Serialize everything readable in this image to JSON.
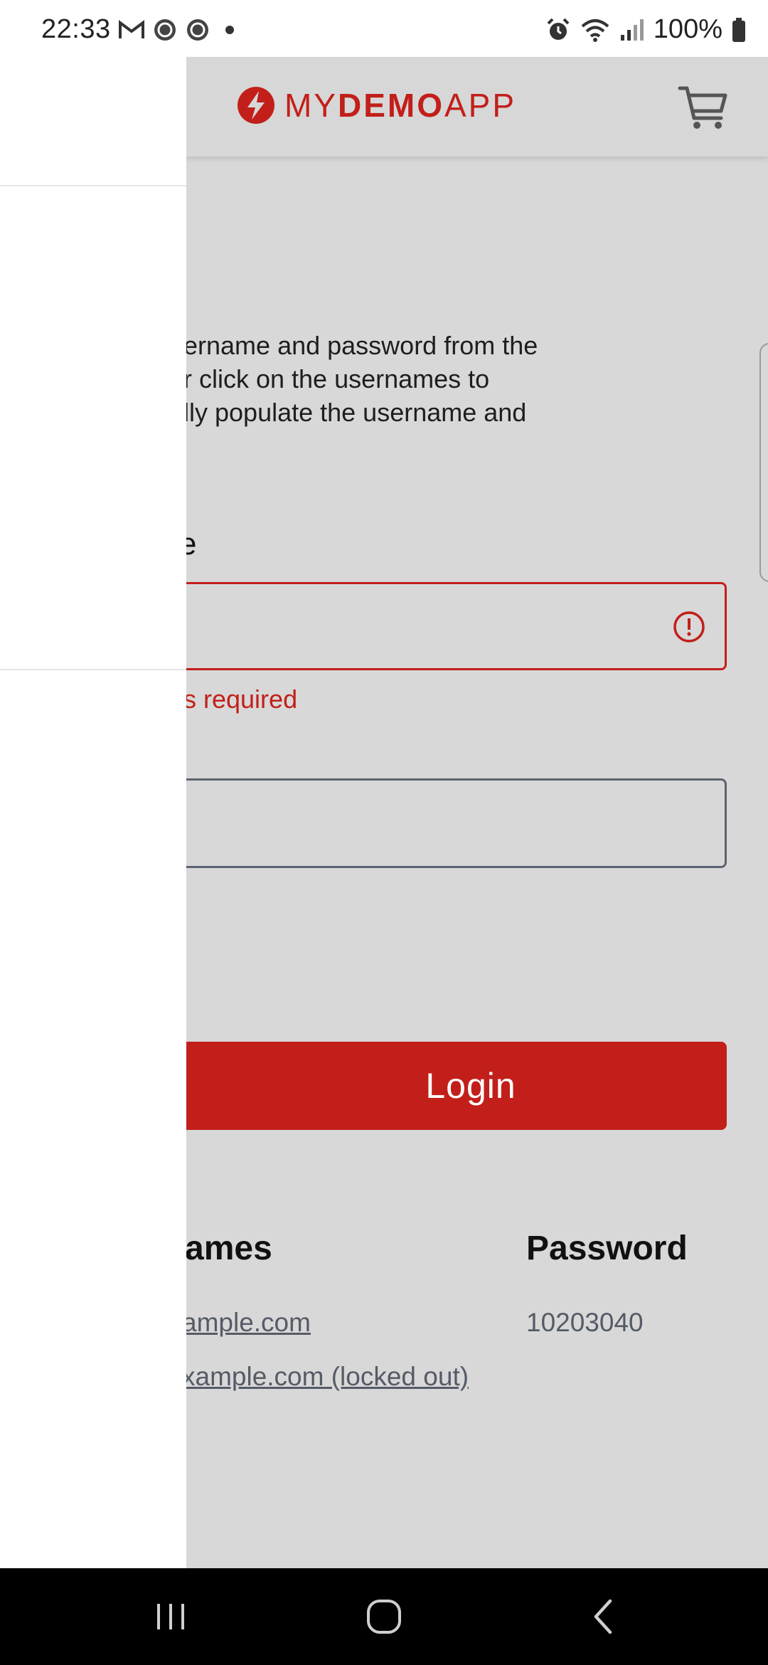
{
  "status_bar": {
    "time": "22:33",
    "battery": "100%",
    "icons": [
      "gmail-icon",
      "app-notification-icon",
      "app-notification-icon",
      "dot-icon",
      "alarm-icon",
      "wifi-icon",
      "signal-icon",
      "battery-icon"
    ]
  },
  "header": {
    "logo_my": "MY",
    "logo_demo": "DEMO",
    "logo_app": "APP",
    "brand_color": "#c21f1a",
    "cart_icon": "cart-icon"
  },
  "login": {
    "description_lines": [
      "ername and password from the",
      "r click on the usernames to",
      "lly populate the username and"
    ],
    "username_label": "e",
    "username_error": "s required",
    "login_button": "Login"
  },
  "credentials": {
    "header_usernames": "ames",
    "header_password": "Password",
    "rows": [
      {
        "username": "ample.com",
        "password": "10203040"
      },
      {
        "username": "xample.com (locked out)",
        "password": ""
      }
    ]
  }
}
